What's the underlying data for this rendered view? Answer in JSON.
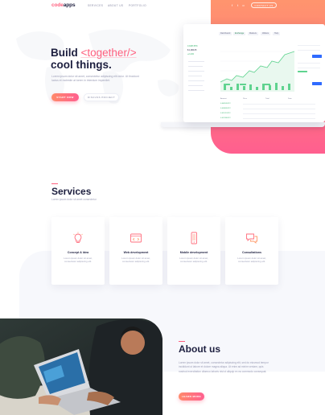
{
  "brand": {
    "logo_accent": "code",
    "logo_rest": "apps",
    "accent_color": "#ff5f7e",
    "gradient_start": "#ff9a6a",
    "gradient_end": "#ff5f8f"
  },
  "nav": {
    "links": [
      "SERVICES",
      "ABOUT US",
      "PORTFOLIO"
    ],
    "social_icons": [
      "facebook-icon",
      "twitter-icon",
      "instagram-icon"
    ],
    "contact_label": "CONTACT US"
  },
  "hero": {
    "title_word": "Build",
    "title_tag": "<together/>",
    "title_line2": "cool things.",
    "description": "Lorem ipsum dolor sit amet, consectetur adipiscing elit dolor. Ut tincidunt luctus et molestie at lorem in interdum imperdiet.",
    "primary_button": "START NOW",
    "secondary_button": "DISCUSS PROJECT"
  },
  "dashboard": {
    "tabs": [
      "Dashboard",
      "Exchange",
      "Markets",
      "Wallets",
      "Help"
    ],
    "balance_values": [
      "0.0183 BTC",
      "$ 1,984.05",
      "+2.21%"
    ],
    "table_headers": [
      "Amount",
      "Price",
      "Total",
      "Date"
    ],
    "table_values": [
      "0.04853 BTC",
      "0.00983 BTC",
      "0.02411 BTC",
      "0.01298 BTC"
    ]
  },
  "services": {
    "title": "Services",
    "subtitle": "Lorem ipsum dolor sit amet consectetur",
    "items": [
      {
        "icon": "lightbulb-icon",
        "title": "Concept & Idea",
        "desc": "Lorem ipsum dolor sit amet, consectetur adipiscing elit."
      },
      {
        "icon": "code-window-icon",
        "title": "Web development",
        "desc": "Lorem ipsum dolor sit amet, consectetur adipiscing elit."
      },
      {
        "icon": "mobile-phone-icon",
        "title": "Mobile development",
        "desc": "Lorem ipsum dolor sit amet, consectetur adipiscing elit."
      },
      {
        "icon": "chat-bubbles-icon",
        "title": "Consultations",
        "desc": "Lorem ipsum dolor sit amet, consectetur adipiscing elit."
      }
    ]
  },
  "about": {
    "title": "About us",
    "description": "Lorem ipsum dolor sit amet, consectetur adipiscing elit, sed do eiusmod tempor incididunt ut labore et dolore magna aliqua. Ut enim ad minim veniam, quis nostrud exercitation ullamco laboris nisi ut aliquip ex ea commodo consequat.",
    "button": "LEARN MORE"
  }
}
